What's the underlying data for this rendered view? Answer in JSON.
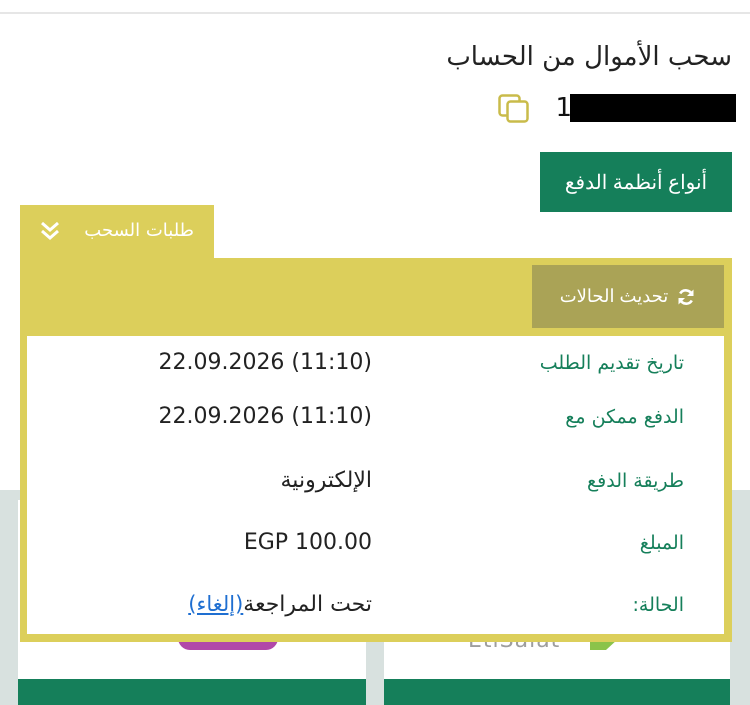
{
  "header": {
    "title": "سحب الأموال من الحساب",
    "account_number_prefix": "1",
    "copy_icon": "copy-icon"
  },
  "payment_types_button": "أنواع أنظمة الدفع",
  "withdrawals_tab": {
    "label": "طلبات السحب",
    "icon": "double-chevron-down-icon"
  },
  "refresh_button": {
    "label": "تحديث الحالات",
    "icon": "refresh-icon"
  },
  "details": {
    "submission_date": {
      "label": "تاريخ تقديم الطلب",
      "value": "22.09.2026 (11:10)"
    },
    "payment_possible_from": {
      "label": "الدفع ممكن مع",
      "value": "22.09.2026 (11:10)"
    },
    "payment_method": {
      "label": "طريقة الدفع",
      "value": "الإلكترونية"
    },
    "amount": {
      "label": "المبلغ",
      "value": "EGP 100.00"
    },
    "status": {
      "label": "الحالة:",
      "value": "تحت المراجعة",
      "cancel_link": "(إلغاء)"
    }
  },
  "colors": {
    "primary_green": "#157f5a",
    "panel_yellow": "#dccf5b",
    "refresh_olive": "#aaa356",
    "link_blue": "#1f6fd1"
  }
}
